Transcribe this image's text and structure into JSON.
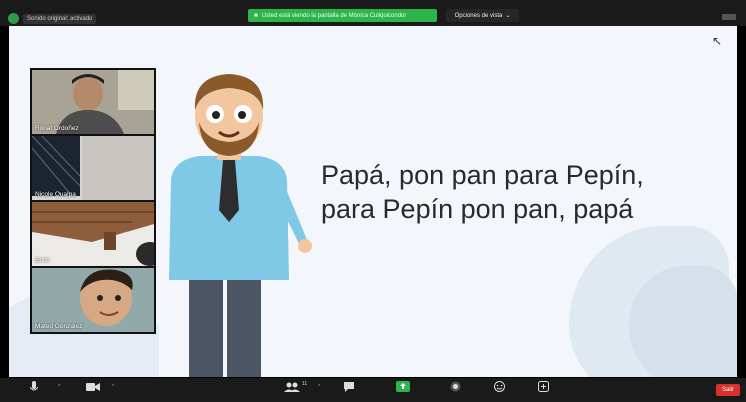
{
  "top": {
    "original_sound": "Sonido original: activado",
    "sharing_banner": "Usted está viendo la pantalla de Mónica Culiquicondor",
    "view_options": "Opciones de vista"
  },
  "slide": {
    "tongue_twister_line1": "Papá, pon pan para Pepín,",
    "tongue_twister_line2": "para Pepín pon pan, papá"
  },
  "participants": [
    {
      "name": "Ronal Ordoñez"
    },
    {
      "name": "Nicole Qualpa"
    },
    {
      "name": "Erick"
    },
    {
      "name": "Mateo Gonzalez"
    }
  ],
  "toolbar": {
    "participants_count": "11",
    "leave_label": "Salir"
  },
  "colors": {
    "share_green": "#2fb44c",
    "leave_red": "#d8312d",
    "toolbar_bg": "#1a1a1a"
  },
  "icons": [
    "mic-icon",
    "video-icon",
    "participants-icon",
    "chat-icon",
    "share-screen-icon",
    "record-icon",
    "reactions-icon",
    "apps-icon",
    "cursor-icon",
    "shield-icon"
  ]
}
